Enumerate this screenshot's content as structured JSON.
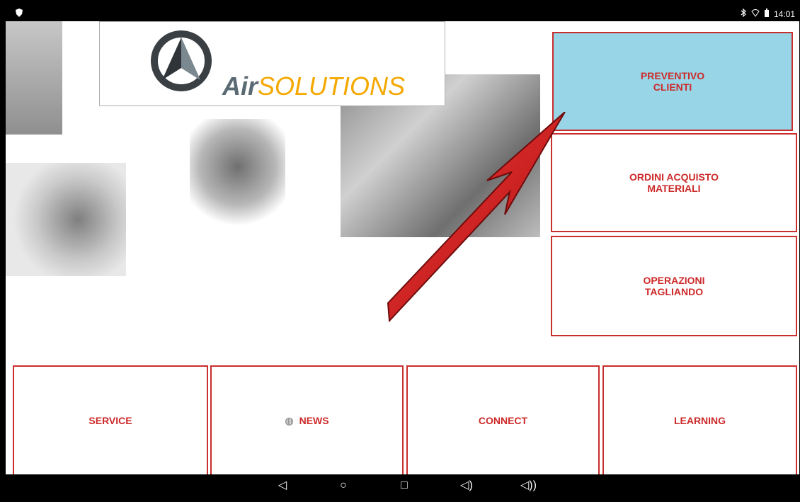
{
  "status": {
    "time": "14:01"
  },
  "logo": {
    "air": "Air",
    "solutions": "SOLUTIONS"
  },
  "tiles": {
    "preventivo": "PREVENTIVO\nCLIENTI",
    "ordini": "ORDINI ACQUISTO\nMATERIALI",
    "operazioni": "OPERAZIONI\nTAGLIANDO",
    "service": "SERVICE",
    "news": "NEWS",
    "connect": "CONNECT",
    "learning": "LEARNING"
  },
  "icons": {
    "status_left": "shield-icon",
    "bluetooth": "bluetooth-icon",
    "wifi": "wifi-icon",
    "battery": "battery-icon",
    "back": "back-icon",
    "home": "home-icon",
    "recents": "recents-icon",
    "volume_down": "volume-down-icon",
    "volume_up": "volume-up-icon",
    "arrow": "pointer-arrow-icon"
  },
  "colors": {
    "accent": "#c92e2e",
    "active_tile": "#98d5e7",
    "logo_gray": "#5a6a73",
    "logo_yellow": "#f4a800"
  }
}
